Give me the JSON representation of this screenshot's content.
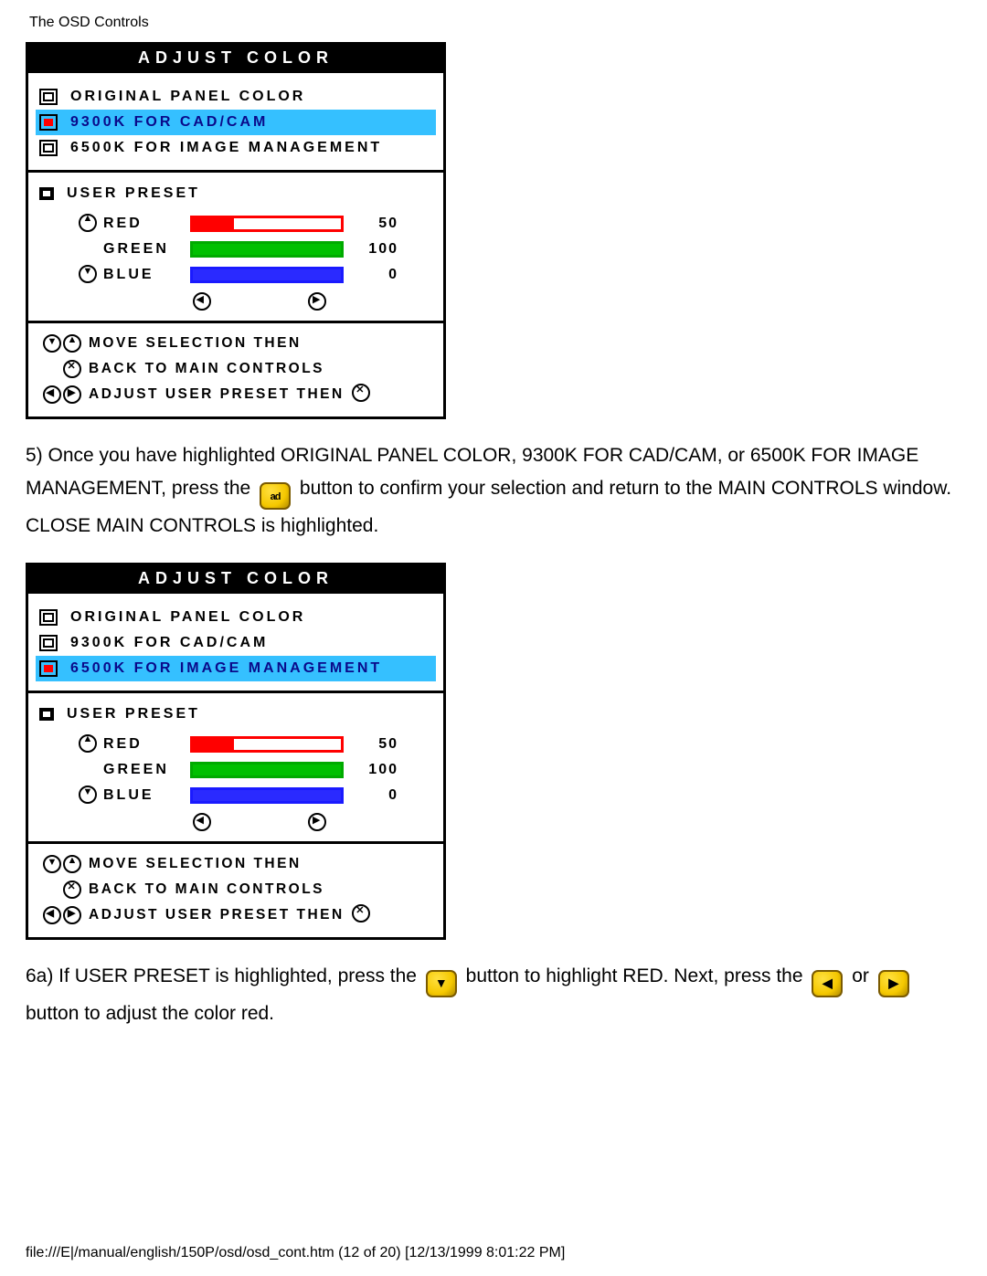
{
  "page_header": "The OSD Controls",
  "osd": {
    "title": "ADJUST COLOR",
    "options": [
      "ORIGINAL PANEL COLOR",
      "9300K FOR CAD/CAM",
      "6500K FOR IMAGE MANAGEMENT"
    ],
    "user_preset_label": "USER PRESET",
    "channels": {
      "red": {
        "label": "RED",
        "value": "50"
      },
      "green": {
        "label": "GREEN",
        "value": "100"
      },
      "blue": {
        "label": "BLUE",
        "value": "0"
      }
    },
    "hints": {
      "move": "MOVE SELECTION THEN",
      "back": "BACK TO MAIN CONTROLS",
      "adjust": "ADJUST USER PRESET THEN"
    }
  },
  "panel1_highlight_index": 1,
  "panel2_highlight_index": 2,
  "para5_a": "5) Once you have highlighted ORIGINAL PANEL COLOR, 9300K FOR CAD/CAM, or 6500K FOR IMAGE MANAGEMENT, press the ",
  "para5_b": " button to confirm your selection and return to the MAIN CONTROLS window. CLOSE MAIN CONTROLS is highlighted.",
  "para6_a": "6a) If USER PRESET is highlighted, press the ",
  "para6_b": " button to highlight RED. Next, press the ",
  "para6_c": " or ",
  "para6_d": " button to adjust the color red.",
  "footer": "file:///E|/manual/english/150P/osd/osd_cont.htm (12 of 20) [12/13/1999 8:01:22 PM]"
}
